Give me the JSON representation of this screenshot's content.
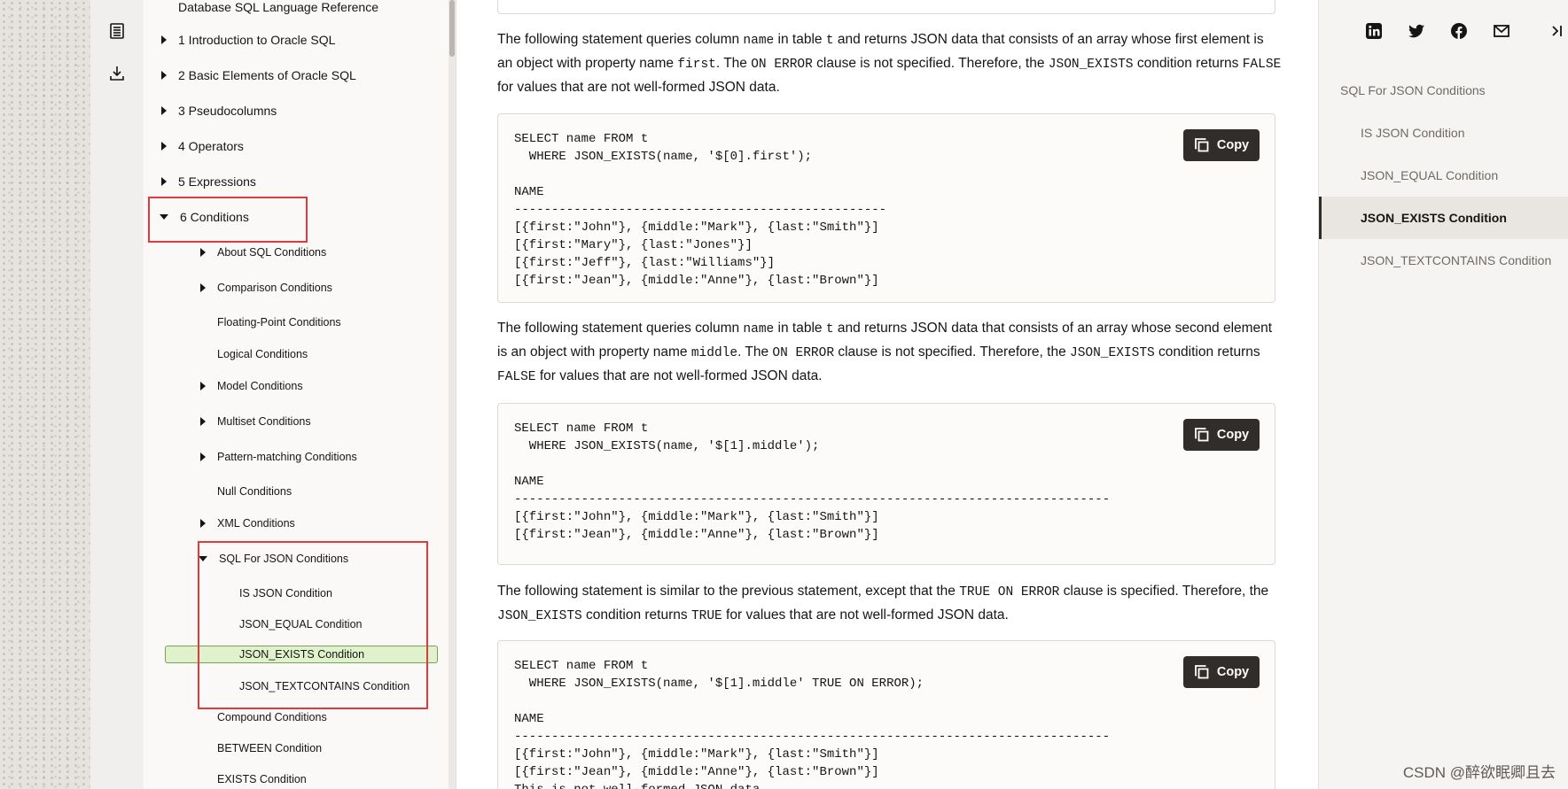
{
  "rail": {
    "icons": [
      "toc-icon",
      "download-icon"
    ]
  },
  "toc": {
    "top_item": "Database SQL Language Reference",
    "items": [
      {
        "label": "1 Introduction to Oracle SQL"
      },
      {
        "label": "2 Basic Elements of Oracle SQL"
      },
      {
        "label": "3 Pseudocolumns"
      },
      {
        "label": "4 Operators"
      },
      {
        "label": "5 Expressions"
      },
      {
        "label": "6 Conditions"
      }
    ],
    "conditions": [
      {
        "label": "About SQL Conditions"
      },
      {
        "label": "Comparison Conditions"
      },
      {
        "label": "Floating-Point Conditions"
      },
      {
        "label": "Logical Conditions"
      },
      {
        "label": "Model Conditions"
      },
      {
        "label": "Multiset Conditions"
      },
      {
        "label": "Pattern-matching Conditions"
      },
      {
        "label": "Null Conditions"
      },
      {
        "label": "XML Conditions"
      },
      {
        "label": "SQL For JSON Conditions"
      }
    ],
    "json_children": [
      {
        "label": "IS JSON Condition"
      },
      {
        "label": "JSON_EQUAL Condition"
      },
      {
        "label": "JSON_EXISTS Condition"
      },
      {
        "label": "JSON_TEXTCONTAINS Condition"
      }
    ],
    "after": [
      {
        "label": "Compound Conditions"
      },
      {
        "label": "BETWEEN Condition"
      },
      {
        "label": "EXISTS Condition"
      }
    ]
  },
  "main": {
    "p1": {
      "a": "The following statement queries column ",
      "b": "name",
      "c": " in table ",
      "d": "t",
      "e": " and returns JSON data that consists of an array whose first element is an object with property name ",
      "f": "first",
      "g": ". The ",
      "h": "ON ERROR",
      "i": " clause is not specified. Therefore, the ",
      "j": "JSON_EXISTS",
      "k": " condition returns ",
      "l": "FALSE",
      "m": " for values that are not well-formed JSON data."
    },
    "code1": "SELECT name FROM t\n  WHERE JSON_EXISTS(name, '$[0].first');\n\nNAME\n--------------------------------------------------\n[{first:\"John\"}, {middle:\"Mark\"}, {last:\"Smith\"}]\n[{first:\"Mary\"}, {last:\"Jones\"}]\n[{first:\"Jeff\"}, {last:\"Williams\"}]\n[{first:\"Jean\"}, {middle:\"Anne\"}, {last:\"Brown\"}]",
    "p2": {
      "a": "The following statement queries column ",
      "b": "name",
      "c": " in table ",
      "d": "t",
      "e": " and returns JSON data that consists of an array whose second element is an object with property name ",
      "f": "middle",
      "g": ". The ",
      "h": "ON ERROR",
      "i": " clause is not specified. Therefore, the ",
      "j": "JSON_EXISTS",
      "k": " condition returns ",
      "l": "FALSE",
      "m": " for values that are not well-formed JSON data."
    },
    "code2": "SELECT name FROM t\n  WHERE JSON_EXISTS(name, '$[1].middle');\n\nNAME\n--------------------------------------------------------------------------------\n[{first:\"John\"}, {middle:\"Mark\"}, {last:\"Smith\"}]\n[{first:\"Jean\"}, {middle:\"Anne\"}, {last:\"Brown\"}]",
    "p3": {
      "a": "The following statement is similar to the previous statement, except that the ",
      "b": "TRUE ON ERROR",
      "c": " clause is specified. Therefore, the ",
      "d": "JSON_EXISTS",
      "e": " condition returns ",
      "f": "TRUE",
      "g": " for values that are not well-formed JSON data."
    },
    "code3": "SELECT name FROM t\n  WHERE JSON_EXISTS(name, '$[1].middle' TRUE ON ERROR);\n\nNAME\n--------------------------------------------------------------------------------\n[{first:\"John\"}, {middle:\"Mark\"}, {last:\"Smith\"}]\n[{first:\"Jean\"}, {middle:\"Anne\"}, {last:\"Brown\"}]\nThis is not well-formed JSON data",
    "copy_label": "Copy"
  },
  "right": {
    "social": [
      "linkedin-icon",
      "twitter-icon",
      "facebook-icon",
      "email-icon"
    ],
    "heading": "SQL For JSON Conditions",
    "items": [
      "IS JSON Condition",
      "JSON_EQUAL Condition",
      "JSON_EXISTS Condition",
      "JSON_TEXTCONTAINS Condition"
    ]
  },
  "watermark": "CSDN @醉欲眠卿且去"
}
